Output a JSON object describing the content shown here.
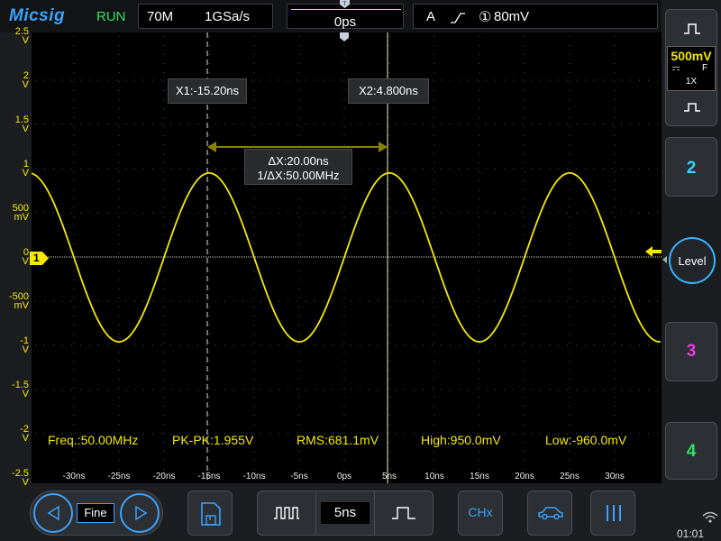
{
  "header": {
    "brand": "Micsig",
    "run_state": "RUN",
    "memory_depth": "70M",
    "sample_rate": "1GSa/s",
    "trigger_position": "0ps",
    "trigger_mode": "A",
    "trigger_source": "①",
    "trigger_level": "80mV"
  },
  "right_panel": {
    "ch1_scale": "500mV",
    "ch1_coupling": "F",
    "ch1_probe": "1X",
    "ch2_label": "2",
    "level_label": "Level",
    "ch3_label": "3",
    "ch4_label": "4"
  },
  "cursors": {
    "x1_label": "X1:-15.20ns",
    "x2_label": "X2:4.800ns",
    "delta_x": "ΔX:20.00ns",
    "inv_delta_x": "1/ΔX:50.00MHz",
    "x1_time_ns": -15.2,
    "x2_time_ns": 4.8
  },
  "channel_marker": "1",
  "y_axis_labels": [
    {
      "v": 2.5,
      "text": "2.5",
      "unit": "V"
    },
    {
      "v": 2.0,
      "text": "2",
      "unit": "V"
    },
    {
      "v": 1.5,
      "text": "1.5",
      "unit": "V"
    },
    {
      "v": 1.0,
      "text": "1",
      "unit": "V"
    },
    {
      "v": 0.5,
      "text": "500",
      "unit": "mV"
    },
    {
      "v": 0.0,
      "text": "0",
      "unit": "V"
    },
    {
      "v": -0.5,
      "text": "-500",
      "unit": "mV"
    },
    {
      "v": -1.0,
      "text": "-1",
      "unit": "V"
    },
    {
      "v": -1.5,
      "text": "-1.5",
      "unit": "V"
    },
    {
      "v": -2.0,
      "text": "-2",
      "unit": "V"
    },
    {
      "v": -2.5,
      "text": "-2.5",
      "unit": "V"
    }
  ],
  "x_axis_labels": [
    {
      "t": -30,
      "text": "-30ns"
    },
    {
      "t": -25,
      "text": "-25ns"
    },
    {
      "t": -20,
      "text": "-20ns"
    },
    {
      "t": -15,
      "text": "-15ns"
    },
    {
      "t": -10,
      "text": "-10ns"
    },
    {
      "t": -5,
      "text": "-5ns"
    },
    {
      "t": 0,
      "text": "0ps"
    },
    {
      "t": 5,
      "text": "5ns"
    },
    {
      "t": 10,
      "text": "10ns"
    },
    {
      "t": 15,
      "text": "15ns"
    },
    {
      "t": 20,
      "text": "20ns"
    },
    {
      "t": 25,
      "text": "25ns"
    },
    {
      "t": 30,
      "text": "30ns"
    }
  ],
  "measurements": {
    "freq": "Freq.:50.00MHz",
    "pkpk": "PK-PK:1.955V",
    "rms": "RMS:681.1mV",
    "high": "High:950.0mV",
    "low": "Low:-960.0mV"
  },
  "waveform": {
    "color": "#f5e800",
    "frequency_mhz": 50,
    "high_v": 0.95,
    "low_v": -0.96,
    "peak_time_ns": 5
  },
  "bottom_bar": {
    "fine_label": "Fine",
    "timebase": "5ns",
    "channel_select": "CHx"
  },
  "status": {
    "clock": "01:01"
  },
  "colors": {
    "trace": "#f5e800",
    "ch2": "#35d5ff",
    "ch3": "#e93ae0",
    "ch4": "#2ee16a",
    "accent": "#3aa3ff"
  }
}
